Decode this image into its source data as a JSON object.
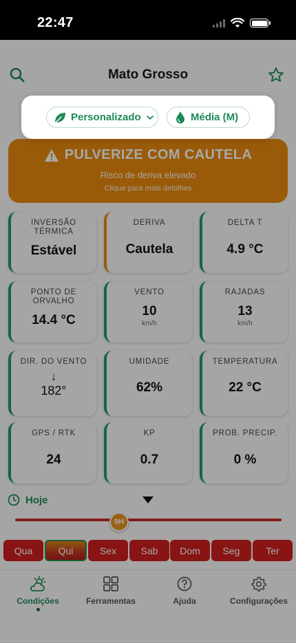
{
  "status_bar": {
    "time": "22:47"
  },
  "header": {
    "title": "Mato Grosso"
  },
  "filters": {
    "profile_label": "Personalizado",
    "droplet_label": "Média (M)"
  },
  "alert": {
    "title": "PULVERIZE COM CAUTELA",
    "subtitle": "Risco de deriva elevado",
    "hint": "Clique para mais detalhes"
  },
  "cards": [
    {
      "label": "Inversão térmica",
      "value": "Estável",
      "unit": "",
      "status": "ok"
    },
    {
      "label": "Deriva",
      "value": "Cautela",
      "unit": "",
      "status": "warn"
    },
    {
      "label": "Delta T",
      "value": "4.9 °C",
      "unit": "",
      "status": "ok"
    },
    {
      "label": "Ponto de orvalho",
      "value": "14.4 °C",
      "unit": "",
      "status": "ok"
    },
    {
      "label": "Vento",
      "value": "10",
      "unit": "km/h",
      "status": "ok"
    },
    {
      "label": "Rajadas",
      "value": "13",
      "unit": "km/h",
      "status": "ok"
    },
    {
      "label": "Dir. do vento",
      "value": "182°",
      "arrow": "↓",
      "status": "ok"
    },
    {
      "label": "Umidade",
      "value": "62%",
      "unit": "",
      "status": "ok"
    },
    {
      "label": "Temperatura",
      "value": "22 °C",
      "unit": "",
      "status": "ok"
    },
    {
      "label": "GPS / RTK",
      "value": "24",
      "unit": "",
      "status": "ok"
    },
    {
      "label": "KP",
      "value": "0.7",
      "unit": "",
      "status": "ok"
    },
    {
      "label": "Prob. precip.",
      "value": "0 %",
      "unit": "",
      "status": "ok"
    }
  ],
  "time_selector": {
    "label": "Hoje",
    "hour_label": "9H"
  },
  "days": [
    "Qua",
    "Qui",
    "Sex",
    "Sab",
    "Dom",
    "Seg",
    "Ter"
  ],
  "selected_day": "Qui",
  "tabs": [
    {
      "label": "Condições",
      "icon": "weather-icon"
    },
    {
      "label": "Ferramentas",
      "icon": "grid-icon"
    },
    {
      "label": "Ajuda",
      "icon": "help-icon"
    },
    {
      "label": "Configurações",
      "icon": "gear-icon"
    }
  ],
  "colors": {
    "brand_green": "#1e8a57",
    "warning_orange": "#e88b0f",
    "danger_red": "#cf1f1f"
  }
}
